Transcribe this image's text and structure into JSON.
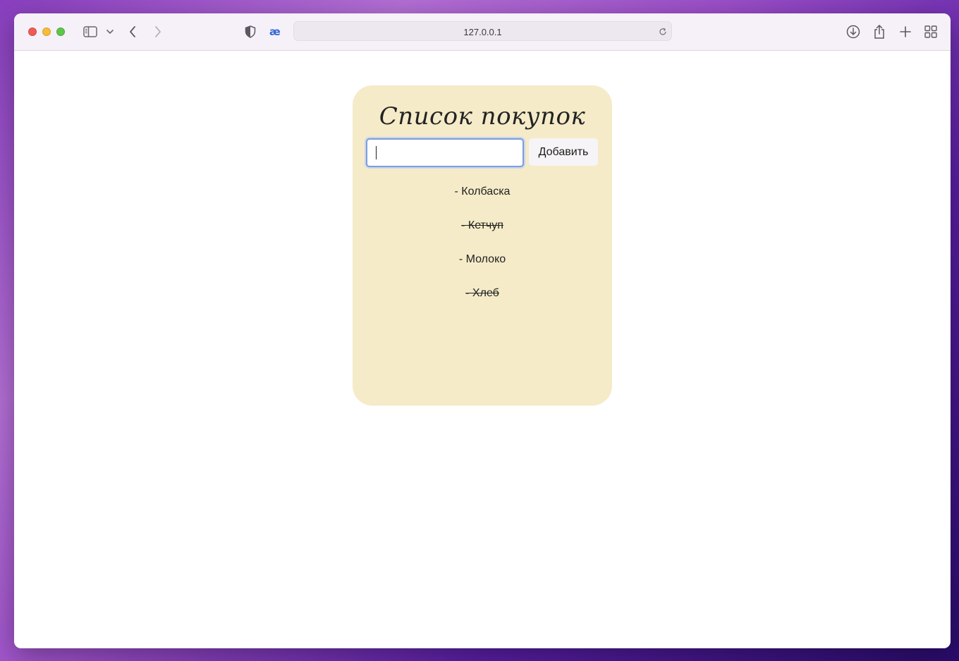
{
  "browser": {
    "address": "127.0.0.1"
  },
  "app": {
    "title": "Список покупок",
    "input_value": "",
    "add_button": "Добавить",
    "items": [
      {
        "text": "- Колбаска",
        "done": false
      },
      {
        "text": "- Кетчуп",
        "done": true
      },
      {
        "text": "- Молоко",
        "done": false
      },
      {
        "text": "- Хлеб",
        "done": true
      }
    ]
  },
  "icons": {
    "sidebar": "sidebar-icon",
    "chevron": "chevron-down-icon",
    "back": "back-icon",
    "forward": "forward-icon",
    "shield": "shield-icon",
    "ae": "ae-extension-icon",
    "download": "download-icon",
    "share": "share-icon",
    "new_tab": "plus-icon",
    "tab_overview": "tab-overview-icon",
    "reload": "reload-icon"
  }
}
